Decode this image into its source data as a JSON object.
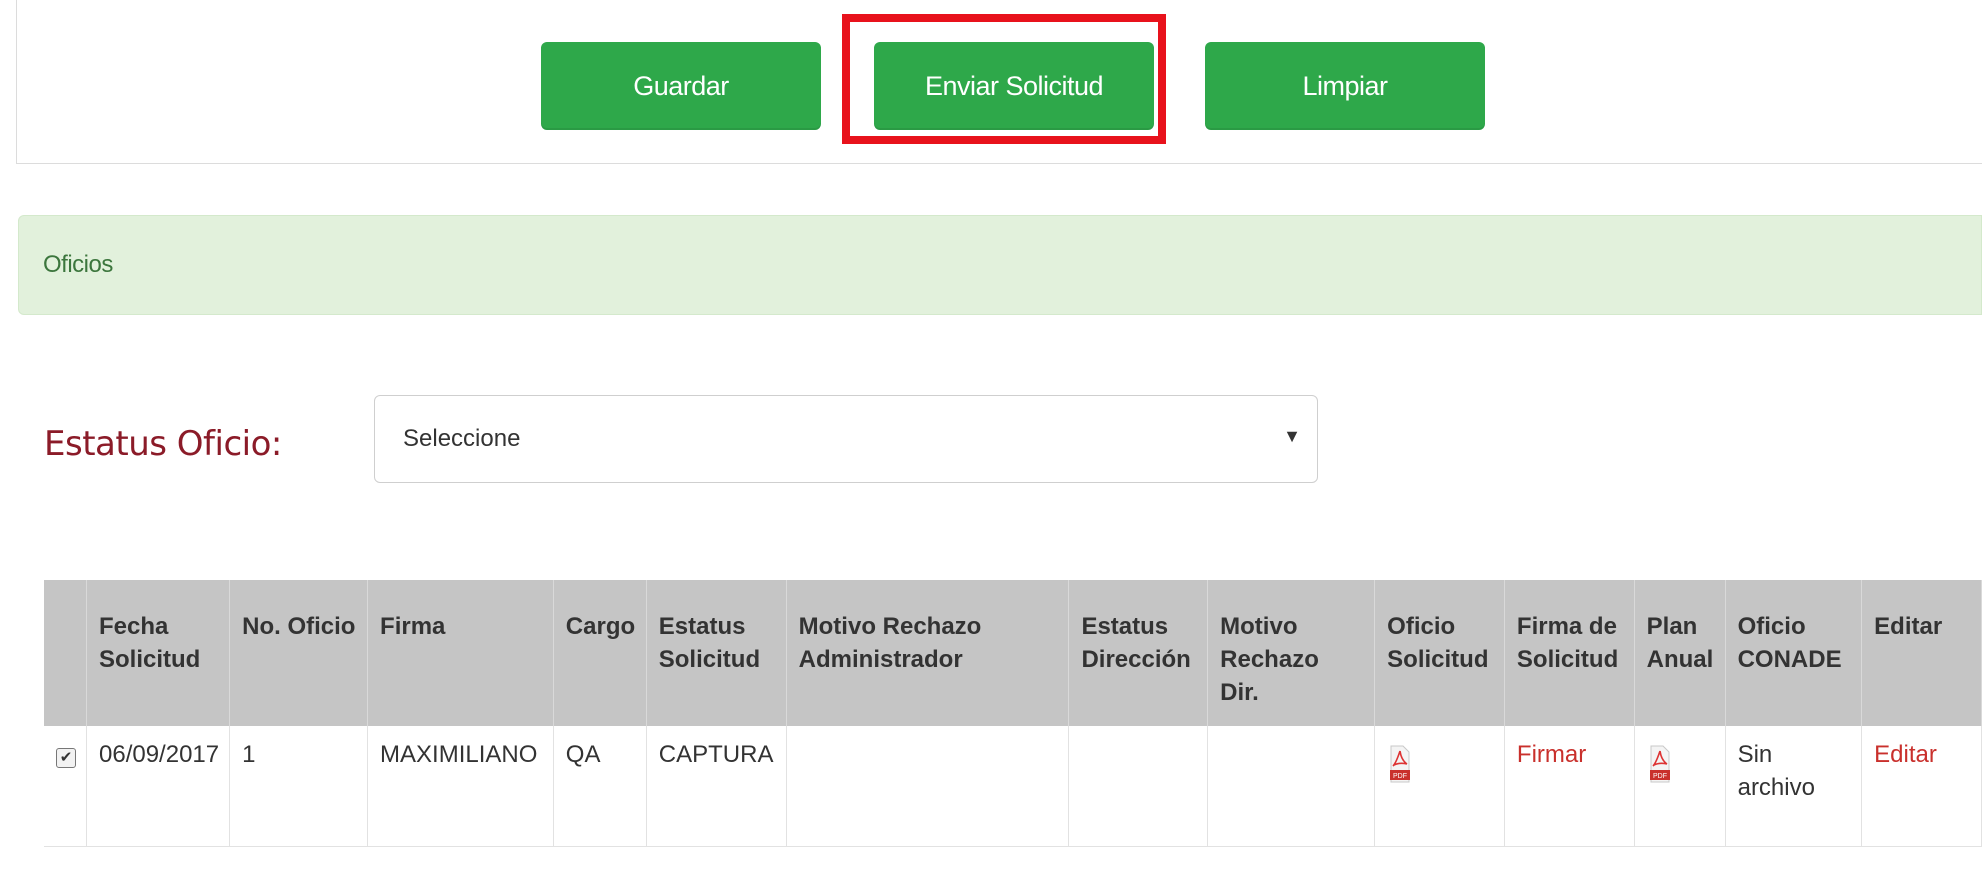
{
  "toolbar": {
    "save_label": "Guardar",
    "send_label": "Enviar Solicitud",
    "clear_label": "Limpiar"
  },
  "panel": {
    "title": "Oficios"
  },
  "filter": {
    "label": "Estatus Oficio:",
    "selected": "Seleccione"
  },
  "table": {
    "headers": [
      "",
      "Fecha Solicitud",
      "No. Oficio",
      "Firma",
      "Cargo",
      "Estatus Solicitud",
      "Motivo Rechazo Administrador",
      "Estatus Dirección",
      "Motivo Rechazo Dir.",
      "Oficio Solicitud",
      "Firma de Solicitud",
      "Plan Anual",
      "Oficio CONADE",
      "Editar"
    ],
    "rows": [
      {
        "checked": true,
        "fecha": "06/09/2017",
        "no_oficio": "1",
        "firma": "MAXIMILIANO",
        "cargo": "QA",
        "estatus_solicitud": "CAPTURA",
        "motivo_rechazo_admin": "",
        "estatus_direccion": "",
        "motivo_rechazo_dir": "",
        "oficio_solicitud_icon": "pdf-icon",
        "firma_solicitud_link": "Firmar",
        "plan_anual_icon": "pdf-icon",
        "oficio_conade": "Sin archivo",
        "editar_link": "Editar"
      }
    ]
  },
  "colors": {
    "button_green": "#2ea84a",
    "highlight_red": "#e8121c",
    "panel_green_bg": "#e2f1dc",
    "link_red": "#c9302c",
    "label_maroon": "#8b1b28"
  }
}
